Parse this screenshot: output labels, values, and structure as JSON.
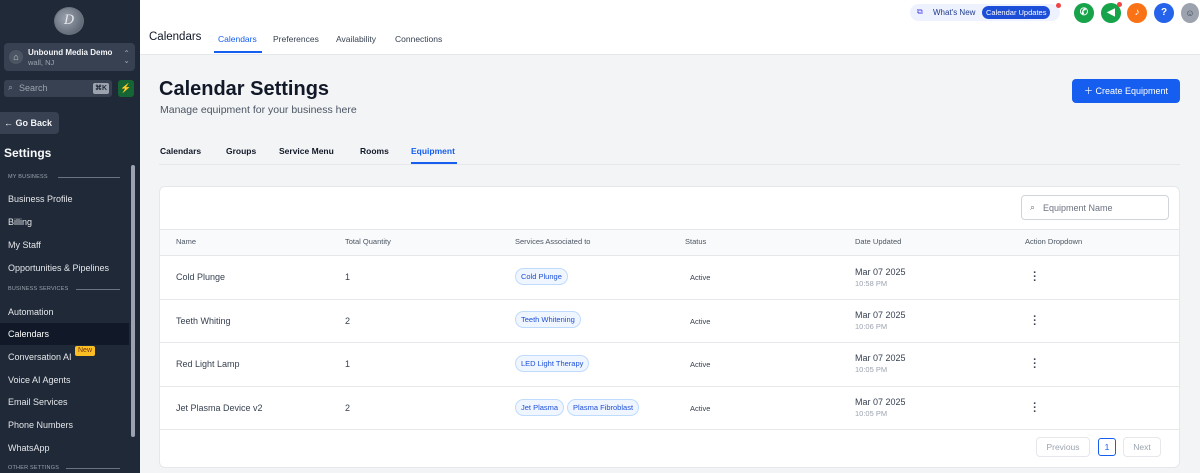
{
  "sidebar": {
    "logo_letter": "D",
    "account": {
      "name": "Unbound Media Demo",
      "location": "wall, NJ"
    },
    "search": {
      "placeholder": "Search",
      "shortcut": "⌘K"
    },
    "go_back": "Go Back",
    "title": "Settings",
    "sections": {
      "my_business": "MY BUSINESS",
      "business_services": "BUSINESS SERVICES",
      "other_settings": "OTHER SETTINGS"
    },
    "items": {
      "business_profile": "Business Profile",
      "billing": "Billing",
      "my_staff": "My Staff",
      "opportunities": "Opportunities & Pipelines",
      "automation": "Automation",
      "calendars": "Calendars",
      "conversation_ai": "Conversation AI",
      "voice_ai": "Voice AI Agents",
      "email_services": "Email Services",
      "phone_numbers": "Phone Numbers",
      "whatsapp": "WhatsApp"
    },
    "new_badge": "New"
  },
  "topbar": {
    "breadcrumb": "Calendars",
    "tabs": {
      "calendars": "Calendars",
      "preferences": "Preferences",
      "availability": "Availability",
      "connections": "Connections"
    },
    "whats_new": "What's New",
    "calendar_updates": "Calendar Updates",
    "help": "?"
  },
  "main": {
    "title": "Calendar Settings",
    "subtitle": "Manage equipment for your business here",
    "create_button": "Create Equipment",
    "subtabs": {
      "calendars": "Calendars",
      "groups": "Groups",
      "service_menu": "Service Menu",
      "rooms": "Rooms",
      "equipment": "Equipment"
    },
    "search_placeholder": "Equipment Name"
  },
  "table": {
    "headers": {
      "name": "Name",
      "qty": "Total Quantity",
      "services": "Services Associated to",
      "status": "Status",
      "date": "Date Updated",
      "action": "Action Dropdown"
    },
    "rows": [
      {
        "name": "Cold Plunge",
        "qty": "1",
        "services": [
          "Cold Plunge"
        ],
        "status": "Active",
        "date": "Mar 07 2025",
        "time": "10:58 PM"
      },
      {
        "name": "Teeth Whiting",
        "qty": "2",
        "services": [
          "Teeth Whitening"
        ],
        "status": "Active",
        "date": "Mar 07 2025",
        "time": "10:06 PM"
      },
      {
        "name": "Red Light Lamp",
        "qty": "1",
        "services": [
          "LED Light Therapy"
        ],
        "status": "Active",
        "date": "Mar 07 2025",
        "time": "10:05 PM"
      },
      {
        "name": "Jet Plasma Device v2",
        "qty": "2",
        "services": [
          "Jet Plasma",
          "Plasma Fibroblast"
        ],
        "status": "Active",
        "date": "Mar 07 2025",
        "time": "10:05 PM"
      }
    ]
  },
  "pagination": {
    "previous": "Previous",
    "page": "1",
    "next": "Next"
  },
  "colors": {
    "accent": "#155eef",
    "sidebar_bg": "#1f2937",
    "phone": "#16a34a",
    "notify": "#f97316"
  },
  "icons": {
    "phone": "phone-icon",
    "megaphone": "megaphone-icon",
    "bell": "bell-icon",
    "help": "help-icon"
  }
}
